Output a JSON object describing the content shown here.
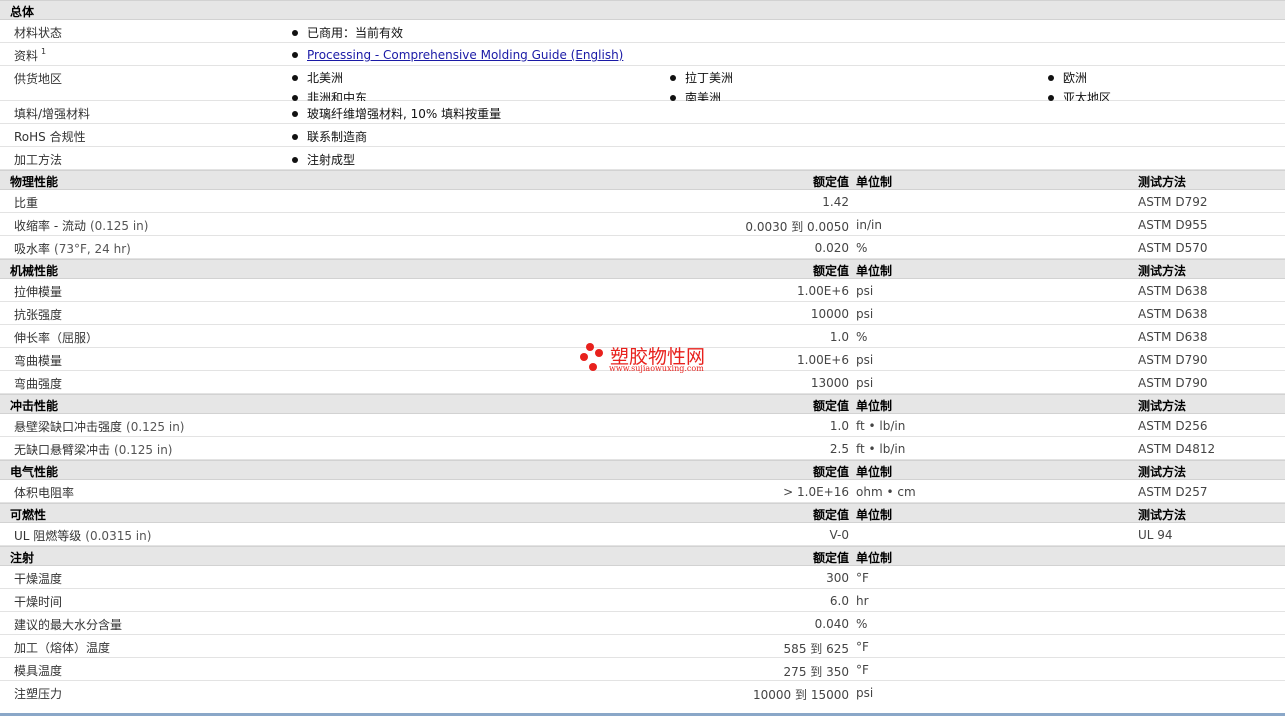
{
  "general": {
    "title": "总体",
    "rows": [
      {
        "label": "材料状态",
        "items": [
          "已商用：当前有效"
        ]
      },
      {
        "label": "资料",
        "sup": "1",
        "link": "Processing - Comprehensive Molding Guide (English)"
      },
      {
        "label": "供货地区",
        "regions": [
          "北美洲",
          "拉丁美洲",
          "欧洲",
          "非洲和中东",
          "南美洲",
          "亚太地区"
        ]
      },
      {
        "label": "填料/增强材料",
        "items": [
          "玻璃纤维增强材料, 10% 填料按重量"
        ]
      },
      {
        "label": "RoHS 合规性",
        "items": [
          "联系制造商"
        ]
      },
      {
        "label": "加工方法",
        "items": [
          "注射成型"
        ]
      }
    ]
  },
  "headers": {
    "value": "额定值",
    "unit": "单位制",
    "test": "测试方法"
  },
  "sections": [
    {
      "title": "物理性能",
      "show_test": true,
      "rows": [
        {
          "label": "比重",
          "cond": "",
          "value": "1.42",
          "unit": "",
          "test": "ASTM D792"
        },
        {
          "label": "收缩率 - 流动",
          "cond": "(0.125 in)",
          "value": "0.0030 到  0.0050",
          "unit": "in/in",
          "test": "ASTM D955"
        },
        {
          "label": "吸水率",
          "cond": "(73°F, 24 hr)",
          "value": "0.020",
          "unit": "%",
          "test": "ASTM D570"
        }
      ]
    },
    {
      "title": "机械性能",
      "show_test": true,
      "rows": [
        {
          "label": "拉伸模量",
          "cond": "",
          "value": "1.00E+6",
          "unit": "psi",
          "test": "ASTM D638"
        },
        {
          "label": "抗张强度",
          "cond": "",
          "value": "10000",
          "unit": "psi",
          "test": "ASTM D638"
        },
        {
          "label": "伸长率（屈服）",
          "cond": "",
          "value": "1.0",
          "unit": "%",
          "test": "ASTM D638"
        },
        {
          "label": "弯曲模量",
          "cond": "",
          "value": "1.00E+6",
          "unit": "psi",
          "test": "ASTM D790"
        },
        {
          "label": "弯曲强度",
          "cond": "",
          "value": "13000",
          "unit": "psi",
          "test": "ASTM D790"
        }
      ]
    },
    {
      "title": "冲击性能",
      "show_test": true,
      "rows": [
        {
          "label": "悬壁梁缺口冲击强度",
          "cond": "(0.125 in)",
          "value": "1.0",
          "unit": "ft • lb/in",
          "test": "ASTM D256"
        },
        {
          "label": "无缺口悬臂梁冲击",
          "cond": "(0.125 in)",
          "value": "2.5",
          "unit": "ft • lb/in",
          "test": "ASTM D4812"
        }
      ]
    },
    {
      "title": "电气性能",
      "show_test": true,
      "rows": [
        {
          "label": "体积电阻率",
          "cond": "",
          "value": "> 1.0E+16",
          "unit": "ohm • cm",
          "test": "ASTM D257"
        }
      ]
    },
    {
      "title": "可燃性",
      "show_test": true,
      "rows": [
        {
          "label": "UL 阻燃等级",
          "cond": "(0.0315 in)",
          "value": "V-0",
          "unit": "",
          "test": "UL 94"
        }
      ]
    },
    {
      "title": "注射",
      "show_test": false,
      "rows": [
        {
          "label": "干燥温度",
          "cond": "",
          "value": "300",
          "unit": "°F",
          "test": ""
        },
        {
          "label": "干燥时间",
          "cond": "",
          "value": "6.0",
          "unit": "hr",
          "test": ""
        },
        {
          "label": "建议的最大水分含量",
          "cond": "",
          "value": "0.040",
          "unit": "%",
          "test": ""
        },
        {
          "label": "加工（熔体）温度",
          "cond": "",
          "value": "585 到  625",
          "unit": "°F",
          "test": ""
        },
        {
          "label": "模具温度",
          "cond": "",
          "value": "275 到  350",
          "unit": "°F",
          "test": ""
        },
        {
          "label": "注塑压力",
          "cond": "",
          "value": "10000 到  15000",
          "unit": "psi",
          "test": ""
        }
      ]
    }
  ],
  "watermark": {
    "text": "塑胶物性网",
    "url": "www.sujiaowuxing.com",
    "color": "#e8211d"
  }
}
